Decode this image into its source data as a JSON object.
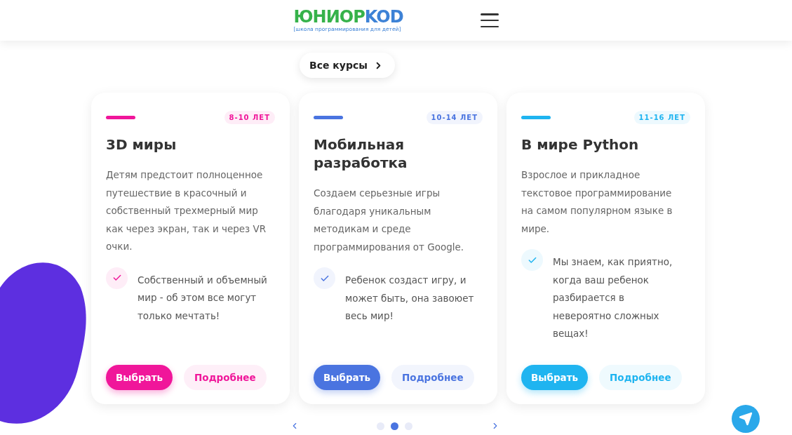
{
  "header": {
    "logo_main": "ЮНИОР",
    "logo_accent": "KOD",
    "logo_tagline": "[школа программирования для детей]"
  },
  "all_courses_button": "Все курсы",
  "courses": [
    {
      "color": "#f0169a",
      "age": "8-10 ЛЕТ",
      "title": "3D миры",
      "description": "Детям предстоит полноценное путешествие в красочный и собственный трехмерный мир как через экран, так и через VR очки.",
      "feature": "Собственный и объемный мир - об этом все могут только мечтать!",
      "choose_button": "Выбрать",
      "details_button": "Подробнее"
    },
    {
      "color": "#4a74e0",
      "age": "10-14 ЛЕТ",
      "title": "Мобильная разработка",
      "description": "Создаем серьезные игры благодаря уникальным методикам и среде программирования от Google.",
      "feature": "Ребенок создаст игру, и может быть, она завоюет весь мир!",
      "choose_button": "Выбрать",
      "details_button": "Подробнее"
    },
    {
      "color": "#1fb4f0",
      "age": "11-16 ЛЕТ",
      "title": "В мире Python",
      "description": "Взрослое и прикладное текстовое программирование на самом популярном языке в мире.",
      "feature": "Мы знаем, как приятно, когда ваш ребенок разбирается в невероятно сложных вещах!",
      "choose_button": "Выбрать",
      "details_button": "Подробнее"
    }
  ],
  "pagination": [
    {
      "selected": false
    },
    {
      "selected": true
    },
    {
      "selected": false
    }
  ]
}
